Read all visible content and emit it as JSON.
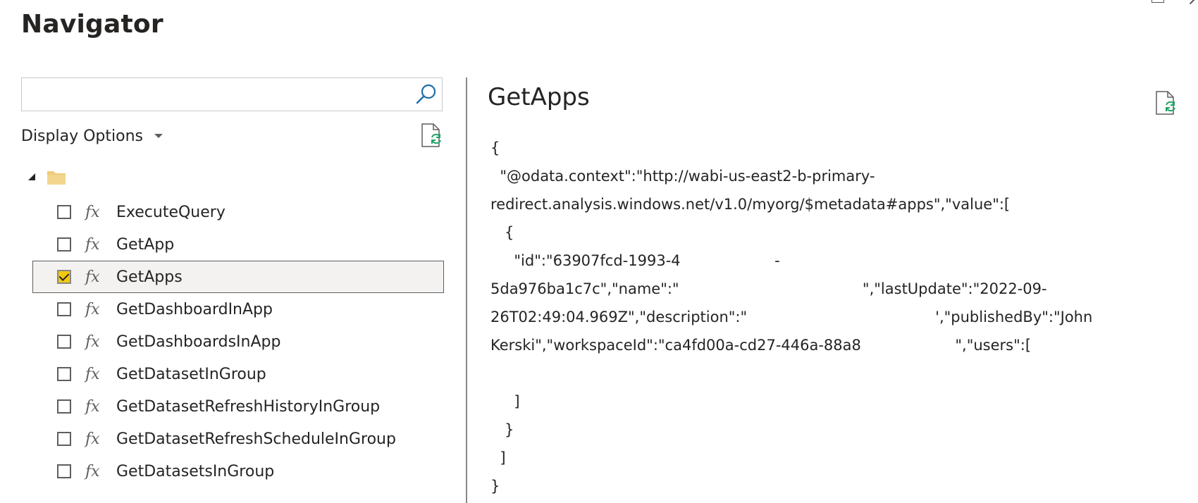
{
  "window": {
    "title": "Navigator"
  },
  "search": {
    "value": "",
    "placeholder": ""
  },
  "display_options": {
    "label": "Display Options"
  },
  "tree": {
    "items": [
      {
        "label": "ExecuteQuery",
        "checked": false
      },
      {
        "label": "GetApp",
        "checked": false
      },
      {
        "label": "GetApps",
        "checked": true
      },
      {
        "label": "GetDashboardInApp",
        "checked": false
      },
      {
        "label": "GetDashboardsInApp",
        "checked": false
      },
      {
        "label": "GetDatasetInGroup",
        "checked": false
      },
      {
        "label": "GetDatasetRefreshHistoryInGroup",
        "checked": false
      },
      {
        "label": "GetDatasetRefreshScheduleInGroup",
        "checked": false
      },
      {
        "label": "GetDatasetsInGroup",
        "checked": false
      }
    ]
  },
  "preview": {
    "title": "GetApps",
    "lines": [
      "{",
      "  \"@odata.context\":\"http://wabi-us-east2-b-primary-",
      "redirect.analysis.windows.net/v1.0/myorg/$metadata#apps\",\"value\":[",
      "   {",
      "     \"id\":\"63907fcd-1993-4                    -",
      "5da976ba1c7c\",\"name\":\"                                       \",\"lastUpdate\":\"2022-09-",
      "26T02:49:04.969Z\",\"description\":\"                                        ',\"publishedBy\":\"John",
      "Kerski\",\"workspaceId\":\"ca4fd00a-cd27-446a-88a8                    \",\"users\":[",
      "",
      "     ]",
      "   }",
      "  ]",
      "}"
    ]
  },
  "colors": {
    "checkbox_checked": "#f2c811",
    "folder": "#f0cb7a",
    "refresh_accent": "#21a366",
    "search_icon": "#1f6fa8"
  }
}
